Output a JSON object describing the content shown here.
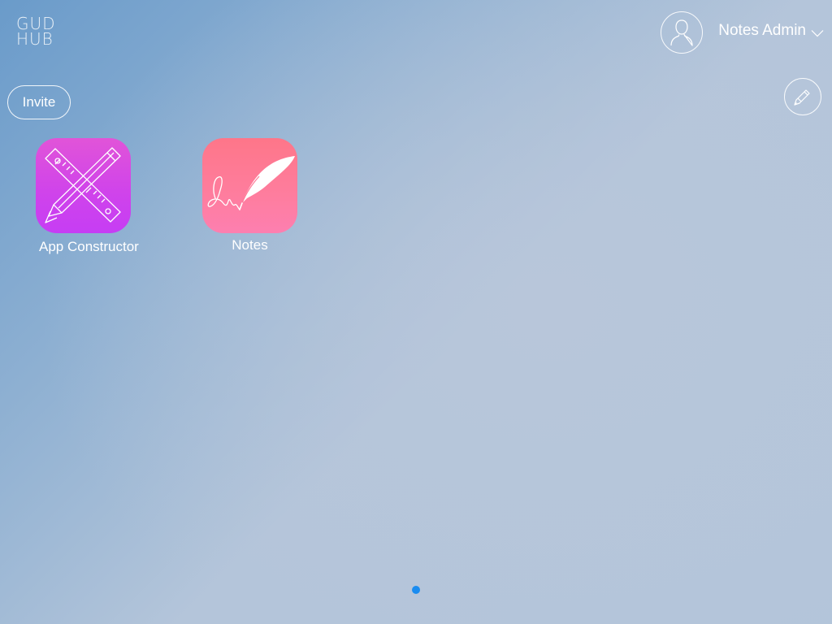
{
  "logo": {
    "line1": "GUD",
    "line2": "HUB"
  },
  "user": {
    "name": "Notes Admin",
    "avatar_icon": "user-silhouette-icon",
    "menu_icon": "chevron-down-icon"
  },
  "toolbar": {
    "invite_label": "Invite",
    "edit_icon": "pencil-icon"
  },
  "apps": [
    {
      "label": "App Constructor",
      "icon": "ruler-pencil-icon",
      "color": "#d446e6"
    },
    {
      "label": "Notes",
      "icon": "quill-signature-icon",
      "color": "#fe7a98"
    }
  ],
  "pagination": {
    "pages": 1,
    "current": 1,
    "active_color": "#1a8cf0"
  }
}
